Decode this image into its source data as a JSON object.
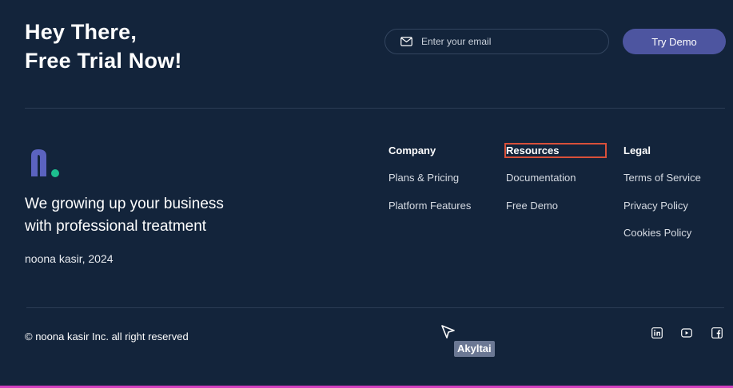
{
  "hero": {
    "line1": "Hey There,",
    "line2": "Free Trial Now!"
  },
  "signup": {
    "email_placeholder": "Enter your email",
    "button_label": "Try Demo"
  },
  "brand": {
    "tagline_line1": "We growing up your business",
    "tagline_line2": "with professional treatment",
    "copyright_year": "noona kasir, 2024",
    "logo_color": "#5b63c0",
    "logo_dot_color": "#1dbf8f"
  },
  "footer_columns": [
    {
      "heading": "Company",
      "links": [
        "Plans & Pricing",
        "Platform Features"
      ]
    },
    {
      "heading": "Resources",
      "links": [
        "Documentation",
        "Free Demo"
      ]
    },
    {
      "heading": "Legal",
      "links": [
        "Terms of Service",
        "Privacy Policy",
        "Cookies Policy"
      ]
    }
  ],
  "bottom": {
    "rights": "© noona kasir Inc. all right reserved",
    "cursor_label": "Akyltai",
    "social": [
      "linkedin-icon",
      "youtube-icon",
      "facebook-icon"
    ]
  },
  "colors": {
    "background": "#13243b",
    "accent": "#4d55a0",
    "highlight": "#d9503a"
  }
}
